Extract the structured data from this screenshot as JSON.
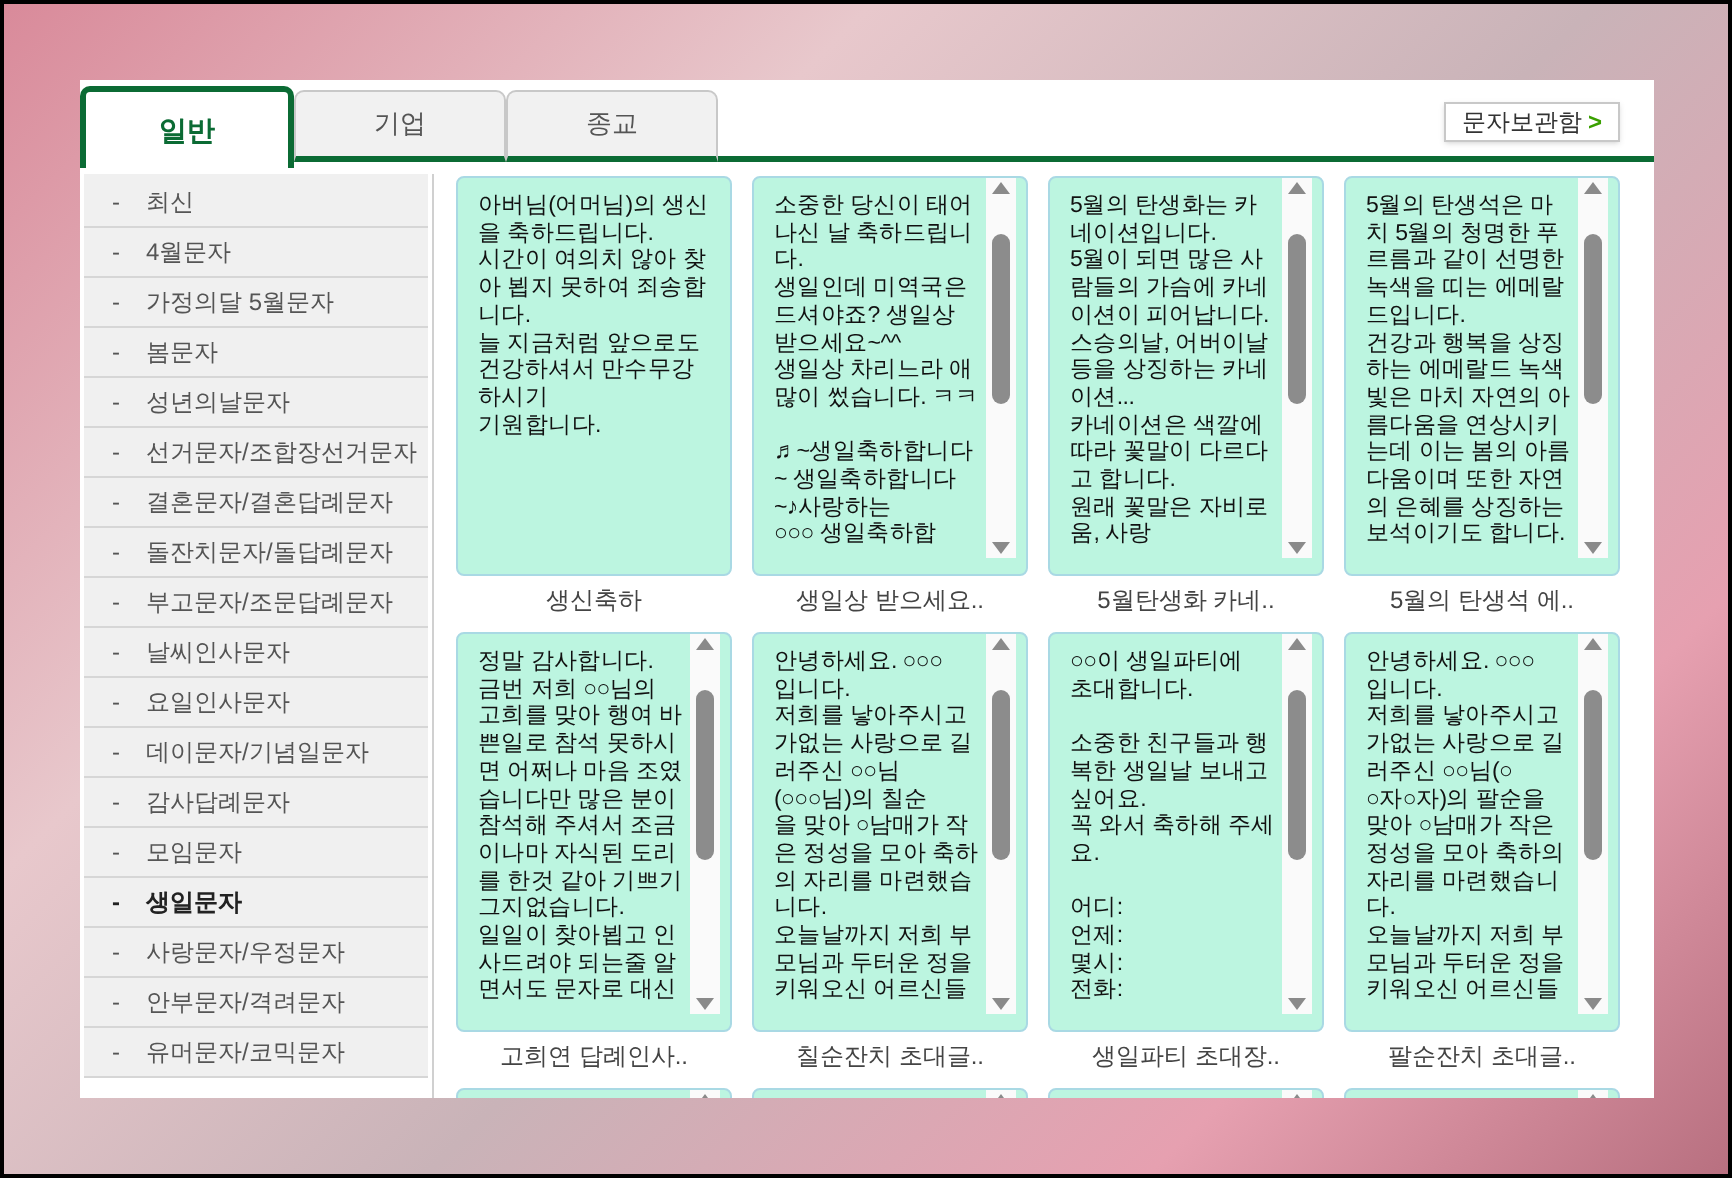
{
  "tabs": [
    {
      "label": "일반",
      "selected": true
    },
    {
      "label": "기업",
      "selected": false
    },
    {
      "label": "종교",
      "selected": false
    }
  ],
  "archive_button": {
    "label": "문자보관함",
    "arrow": ">"
  },
  "sidebar": {
    "bullet": "-",
    "items": [
      {
        "label": "최신",
        "selected": false
      },
      {
        "label": "4월문자",
        "selected": false
      },
      {
        "label": "가정의달 5월문자",
        "selected": false
      },
      {
        "label": "봄문자",
        "selected": false
      },
      {
        "label": "성년의날문자",
        "selected": false
      },
      {
        "label": "선거문자/조합장선거문자",
        "selected": false
      },
      {
        "label": "결혼문자/결혼답례문자",
        "selected": false
      },
      {
        "label": "돌잔치문자/돌답례문자",
        "selected": false
      },
      {
        "label": "부고문자/조문답례문자",
        "selected": false
      },
      {
        "label": "날씨인사문자",
        "selected": false
      },
      {
        "label": "요일인사문자",
        "selected": false
      },
      {
        "label": "데이문자/기념일문자",
        "selected": false
      },
      {
        "label": "감사답례문자",
        "selected": false
      },
      {
        "label": "모임문자",
        "selected": false
      },
      {
        "label": "생일문자",
        "selected": true
      },
      {
        "label": "사랑문자/우정문자",
        "selected": false
      },
      {
        "label": "안부문자/격려문자",
        "selected": false
      },
      {
        "label": "유머문자/코믹문자",
        "selected": false
      }
    ]
  },
  "cards": [
    {
      "scrollbar": false,
      "title": "생신축하",
      "message": "아버님(어머님)의 생신\n을 축하드립니다.\n시간이 여의치 않아 찾\n아 뵙지 못하여 죄송합\n니다.\n늘 지금처럼 앞으로도\n건강하셔서 만수무강\n하시기\n기원합니다."
    },
    {
      "scrollbar": true,
      "title": "생일상 받으세요..",
      "message": "소중한 당신이 태어\n나신 날 축하드립니\n다.\n생일인데 미역국은\n드셔야죠? 생일상\n받으세요~^^\n생일상 차리느라 애\n많이 썼습니다. ㅋㅋ\n\n♬~생일축하합니다\n~ 생일축하합니다\n~♪사랑하는\n○○○ 생일축하합"
    },
    {
      "scrollbar": true,
      "title": "5월탄생화 카네..",
      "message": "5월의 탄생화는 카\n네이션입니다.\n5월이 되면 많은 사\n람들의 가슴에 카네\n이션이 피어납니다.\n스승의날, 어버이날\n등을 상징하는 카네\n이션...\n카네이션은 색깔에\n따라 꽃말이 다르다\n고 합니다.\n원래 꽃말은 자비로\n움, 사랑"
    },
    {
      "scrollbar": true,
      "title": "5월의 탄생석 에..",
      "message": "5월의 탄생석은 마\n치 5월의 청명한 푸\n르름과 같이 선명한\n녹색을 띠는 에메랄\n드입니다.\n건강과 행복을 상징\n하는 에메랄드 녹색\n빛은 마치 자연의 아\n름다움을 연상시키\n는데 이는 봄의 아름\n다움이며 또한 자연\n의 은혜를 상징하는\n보석이기도 합니다."
    },
    {
      "scrollbar": true,
      "title": "고희연 답례인사..",
      "message": "정말 감사합니다.\n금번 저희 ○○님의\n고희를 맞아 행여 바\n쁜일로 참석 못하시\n면 어쩌나 마음 조였\n습니다만 많은 분이\n참석해 주셔서 조금\n이나마 자식된 도리\n를 한것 같아 기쁘기\n그지없습니다.\n일일이 찾아뵙고 인\n사드려야 되는줄 알\n면서도 문자로 대신"
    },
    {
      "scrollbar": true,
      "title": "칠순잔치 초대글..",
      "message": "안녕하세요. ○○○\n입니다.\n저희를 낳아주시고\n가없는 사랑으로 길\n러주신 ○○님\n(○○○님)의 칠순\n을 맞아 ○남매가 작\n은 정성을 모아 축하\n의 자리를 마련했습\n니다.\n오늘날까지 저희 부\n모님과 두터운 정을\n키워오신 어르신들"
    },
    {
      "scrollbar": true,
      "title": "생일파티 초대장..",
      "message": "○○이 생일파티에\n초대합니다.\n\n소중한 친구들과 행\n복한 생일날 보내고\n싶어요.\n꼭 와서 축하해 주세\n요.\n\n어디:\n언제:\n몇시:\n전화:"
    },
    {
      "scrollbar": true,
      "title": "팔순잔치 초대글..",
      "message": "안녕하세요. ○○○\n입니다.\n저희를 낳아주시고\n가없는 사랑으로 길\n러주신 ○○님(○\n○자○자)의 팔순을\n맞아 ○남매가 작은\n정성을 모아 축하의\n자리를 마련했습니\n다.\n오늘날까지 저희 부\n모님과 두터운 정을\n키워오신 어르신들"
    },
    {
      "scrollbar": true
    },
    {
      "scrollbar": true
    },
    {
      "scrollbar": true
    },
    {
      "scrollbar": true
    }
  ]
}
